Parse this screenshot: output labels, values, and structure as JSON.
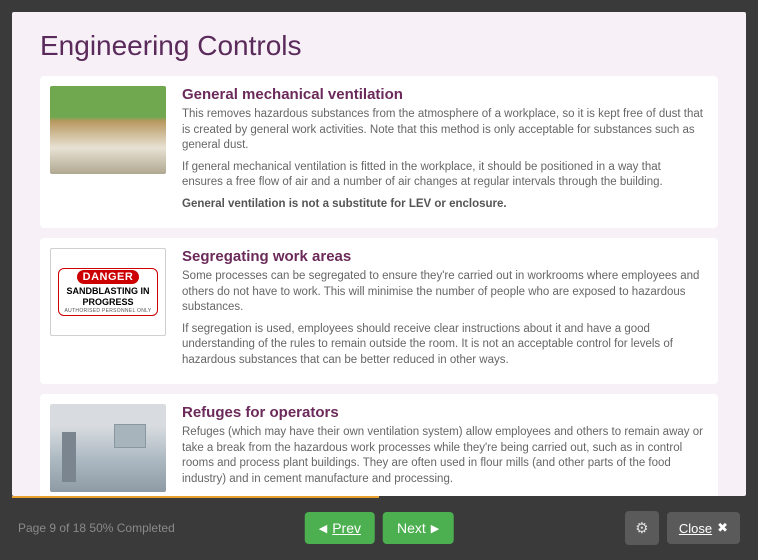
{
  "title": "Engineering Controls",
  "sections": [
    {
      "title": "General mechanical ventilation",
      "p1": "This removes hazardous substances from the atmosphere of a workplace, so it is kept free of dust that is created by general work activities. Note that this method is only acceptable for substances such as general dust.",
      "p2": "If general mechanical ventilation is fitted in the workplace, it should be positioned in a way that ensures a free flow of air and a number of air changes at regular intervals through the building.",
      "p3_bold": "General ventilation is not a substitute for LEV or enclosure."
    },
    {
      "title": "Segregating work areas",
      "p1": "Some processes can be segregated to ensure they're carried out in workrooms where employees and others do not have to work. This will minimise the number of people who are exposed to hazardous substances.",
      "p2": "If segregation is used, employees should receive clear instructions about it and have a good understanding of the rules to remain outside the room. It is not an acceptable control for levels of hazardous substances that can be better reduced in other ways.",
      "sign_top": "DANGER",
      "sign_mid": "SANDBLASTING IN PROGRESS",
      "sign_bot": "AUTHORISED PERSONNEL ONLY"
    },
    {
      "title": "Refuges for operators",
      "p1": "Refuges (which may have their own ventilation system) allow employees and others to remain away or take a break from the hazardous work processes while they're being carried out, such as in control rooms and process plant buildings. They are often used in flour mills (and other parts of the food industry) and in cement manufacture and processing."
    }
  ],
  "footer": {
    "page_info": "Page 9 of 18   50% Completed",
    "prev": "Prev",
    "next": "Next",
    "close": "Close"
  }
}
